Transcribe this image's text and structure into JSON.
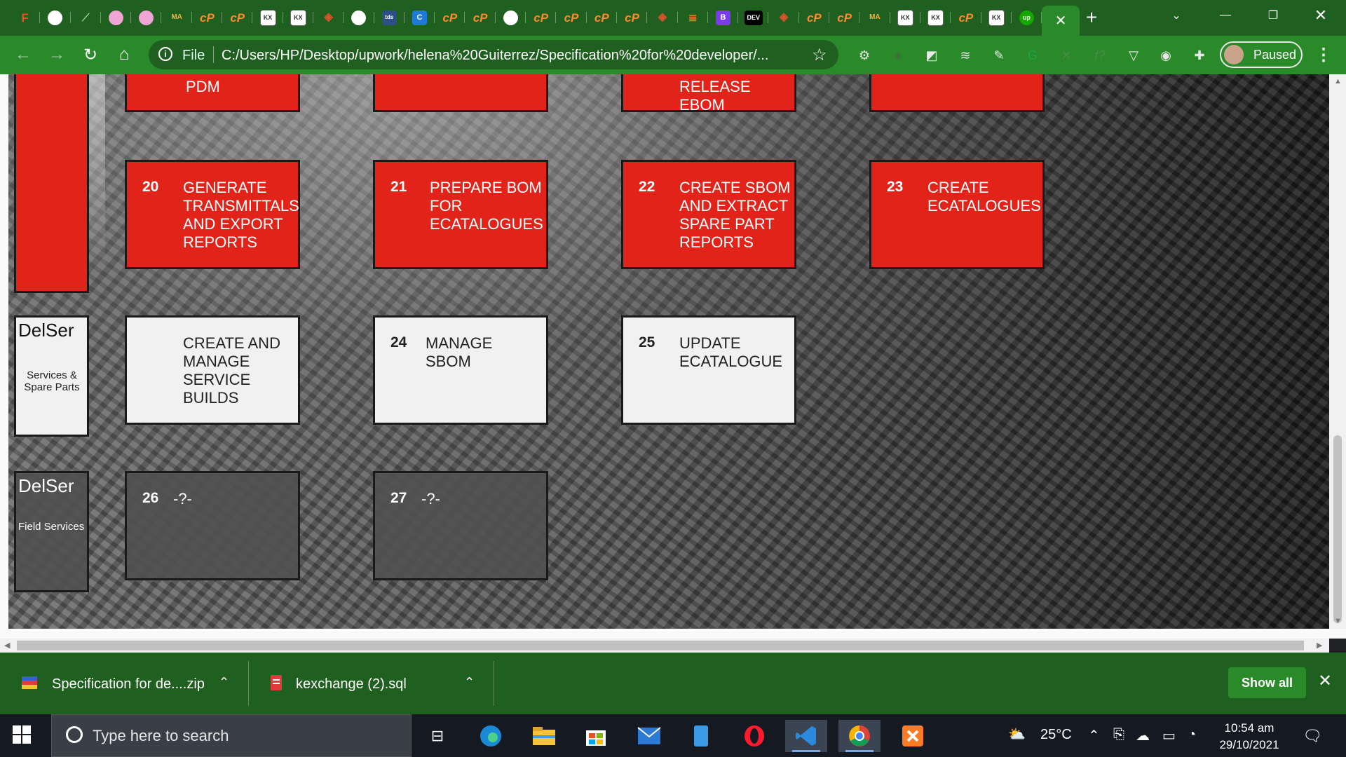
{
  "browser": {
    "tabs": [
      {
        "icon": "figma-icon",
        "glyph": "F",
        "cls": "fig"
      },
      {
        "icon": "chrome-icon",
        "glyph": "",
        "cls": "chrome"
      },
      {
        "icon": "chart-icon",
        "glyph": "⟋",
        "cls": "chart"
      },
      {
        "icon": "pink-app-icon",
        "glyph": "",
        "cls": "pink"
      },
      {
        "icon": "pink-app-icon",
        "glyph": "",
        "cls": "pink"
      },
      {
        "icon": "material-icon",
        "glyph": "MA",
        "cls": "mat"
      },
      {
        "icon": "cp-icon",
        "glyph": "cP",
        "cls": "cp"
      },
      {
        "icon": "cp-icon",
        "glyph": "cP",
        "cls": "cp"
      },
      {
        "icon": "kx-icon",
        "glyph": "KX",
        "cls": "kx"
      },
      {
        "icon": "kx-icon",
        "glyph": "KX",
        "cls": "kx"
      },
      {
        "icon": "laravel-icon",
        "glyph": "◈",
        "cls": "la"
      },
      {
        "icon": "chrome-icon",
        "glyph": "",
        "cls": "chrome"
      },
      {
        "icon": "tds-icon",
        "glyph": "tds",
        "cls": "tds"
      },
      {
        "icon": "c-icon",
        "glyph": "C",
        "cls": "c"
      },
      {
        "icon": "cp-icon",
        "glyph": "cP",
        "cls": "cp"
      },
      {
        "icon": "cp-icon",
        "glyph": "cP",
        "cls": "cp"
      },
      {
        "icon": "chrome-icon",
        "glyph": "",
        "cls": "chrome"
      },
      {
        "icon": "cp-icon",
        "glyph": "cP",
        "cls": "cp"
      },
      {
        "icon": "cp-icon",
        "glyph": "cP",
        "cls": "cp"
      },
      {
        "icon": "cp-icon",
        "glyph": "cP",
        "cls": "cp"
      },
      {
        "icon": "cp-icon",
        "glyph": "cP",
        "cls": "cp"
      },
      {
        "icon": "laravel-icon",
        "glyph": "◈",
        "cls": "la"
      },
      {
        "icon": "stackoverflow-icon",
        "glyph": "≣",
        "cls": "so"
      },
      {
        "icon": "bootstrap-icon",
        "glyph": "B",
        "cls": "b"
      },
      {
        "icon": "dev-icon",
        "glyph": "DEV",
        "cls": "dev"
      },
      {
        "icon": "laravel-icon",
        "glyph": "◈",
        "cls": "la"
      },
      {
        "icon": "cp-icon",
        "glyph": "cP",
        "cls": "cp"
      },
      {
        "icon": "cp-icon",
        "glyph": "cP",
        "cls": "cp"
      },
      {
        "icon": "material-icon",
        "glyph": "MA",
        "cls": "mat"
      },
      {
        "icon": "kx-icon",
        "glyph": "KX",
        "cls": "kx"
      },
      {
        "icon": "kx-icon",
        "glyph": "KX",
        "cls": "kx"
      },
      {
        "icon": "cp-icon",
        "glyph": "cP",
        "cls": "cp"
      },
      {
        "icon": "kx-icon",
        "glyph": "KX",
        "cls": "kx"
      },
      {
        "icon": "upwork-icon",
        "glyph": "up",
        "cls": "up"
      }
    ],
    "url_scheme": "File",
    "url": "C:/Users/HP/Desktop/upwork/helena%20Guiterrez/Specification%20for%20developer/...",
    "profile_label": "Paused",
    "accent": "#2a8a2a",
    "frame": "#1f5f1f"
  },
  "page": {
    "top_row": [
      "PDM",
      "",
      "RELEASE EBOM",
      ""
    ],
    "red_row": [
      {
        "num": "20",
        "text": "GENERATE TRANSMITTALS AND EXPORT REPORTS"
      },
      {
        "num": "21",
        "text": "PREPARE BOM FOR ECATALOGUES"
      },
      {
        "num": "22",
        "text": "CREATE SBOM AND EXTRACT SPARE PART REPORTS"
      },
      {
        "num": "23",
        "text": "CREATE ECATALOGUES"
      }
    ],
    "services": {
      "title": "DelSer",
      "subtitle": "Services & Spare Parts",
      "cards": [
        {
          "num": "",
          "text": "CREATE AND MANAGE SERVICE BUILDS"
        },
        {
          "num": "24",
          "text": "MANAGE SBOM"
        },
        {
          "num": "25",
          "text": "UPDATE ECATALOGUE"
        }
      ]
    },
    "field": {
      "title": "DelSer",
      "subtitle": "Field Services",
      "cards": [
        {
          "num": "26",
          "text": "-?-"
        },
        {
          "num": "27",
          "text": "-?-"
        }
      ]
    },
    "colors": {
      "red": "#e2231a",
      "white": "#f1f1f1",
      "dark": "#505050"
    }
  },
  "downloads": {
    "items": [
      {
        "name": "Specification for de....zip",
        "icon": "zip-file-icon"
      },
      {
        "name": "kexchange (2).sql",
        "icon": "sql-file-icon"
      }
    ],
    "show_all": "Show all"
  },
  "taskbar": {
    "search_placeholder": "Type here to search",
    "weather": "25°C",
    "time": "10:54 am",
    "date": "29/10/2021",
    "apps": [
      "task-view-icon",
      "edge-icon",
      "file-explorer-icon",
      "store-icon",
      "mail-icon",
      "phone-icon",
      "opera-icon",
      "vscode-icon",
      "chrome-icon",
      "xampp-icon"
    ]
  }
}
